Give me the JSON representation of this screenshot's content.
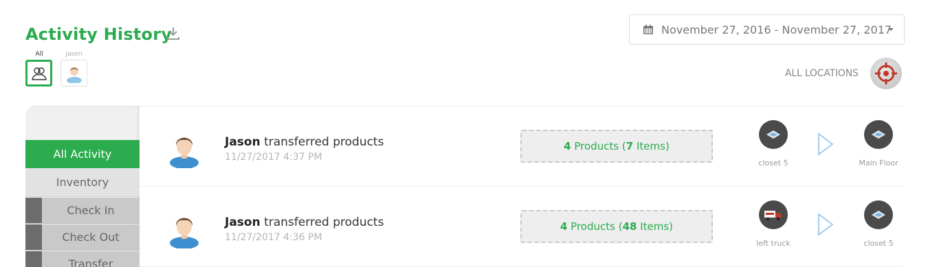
{
  "header": {
    "title": "Activity History",
    "download_icon": "download-icon"
  },
  "user_filter": {
    "all_label": "All",
    "jason_label": "Jason"
  },
  "date_range": {
    "icon": "calendar-icon",
    "text": "November 27, 2016 - November 27, 2017"
  },
  "locations": {
    "label": "ALL LOCATIONS",
    "icon": "crosshair-icon"
  },
  "sidebar": {
    "all_activity": "All Activity",
    "inventory": "Inventory",
    "check_in": "Check In",
    "check_out": "Check Out",
    "transfer": "Transfer"
  },
  "activities": [
    {
      "user": "Jason",
      "action": "transferred products",
      "time": "11/27/2017 4:37 PM",
      "products_count": "4",
      "products_word": "Products (",
      "items_count": "7",
      "items_word": "Items)",
      "from": "closet 5",
      "from_icon": "closet-icon",
      "to": "Main Floor",
      "to_icon": "closet-icon"
    },
    {
      "user": "Jason",
      "action": "transferred products",
      "time": "11/27/2017 4:36 PM",
      "products_count": "4",
      "products_word": "Products (",
      "items_count": "48",
      "items_word": "Items)",
      "from": "left truck",
      "from_icon": "truck-icon",
      "to": "closet 5",
      "to_icon": "closet-icon"
    }
  ],
  "colors": {
    "accent": "#2cab4f",
    "sidebar_dark": "#6c6c6c",
    "sidebar_sub": "#c9c9c9",
    "location_icon_bg": "#4a4a4a",
    "target_red": "#c0392b"
  }
}
